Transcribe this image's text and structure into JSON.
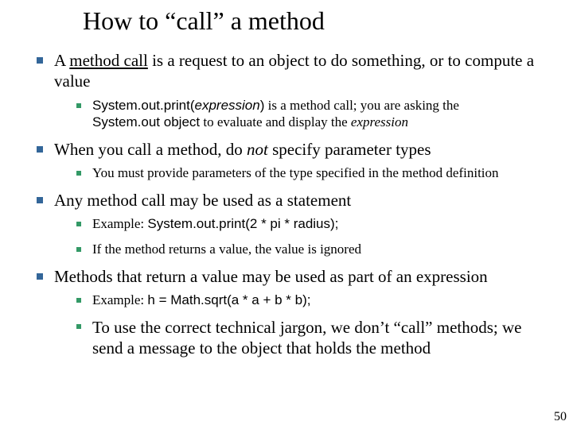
{
  "title": "How to “call” a method",
  "b1": {
    "pre": "A ",
    "u": "method call",
    "post": " is a request to an object to do something, or to compute a value",
    "sub": {
      "code1a": "System.out.print(",
      "code1b": "expression",
      "code1c": ")",
      "mid1": " is a method call; you are asking the",
      "line2a": "System.out ",
      "line2b": "object",
      "line2c": " to evaluate and display the ",
      "line2d": "expression"
    }
  },
  "b2": {
    "pre": "When you call a method, do ",
    "not": "not",
    "post": " specify parameter types",
    "sub": "You must provide parameters of the type specified in the method definition"
  },
  "b3": {
    "text": "Any method call may be used as a statement",
    "sub1": {
      "lead": "Example: ",
      "code": "System.out.print(2 * pi * radius);"
    },
    "sub2": "If the method returns a value, the value is ignored"
  },
  "b4": {
    "text": "Methods that return a value may be used as part of an expression",
    "sub1": {
      "lead": "Example: ",
      "code": "h = Math.sqrt(a * a + b * b);"
    },
    "sub2": "To use the correct technical jargon, we don’t “call” methods; we send a message to the object that holds the method"
  },
  "page": "50"
}
